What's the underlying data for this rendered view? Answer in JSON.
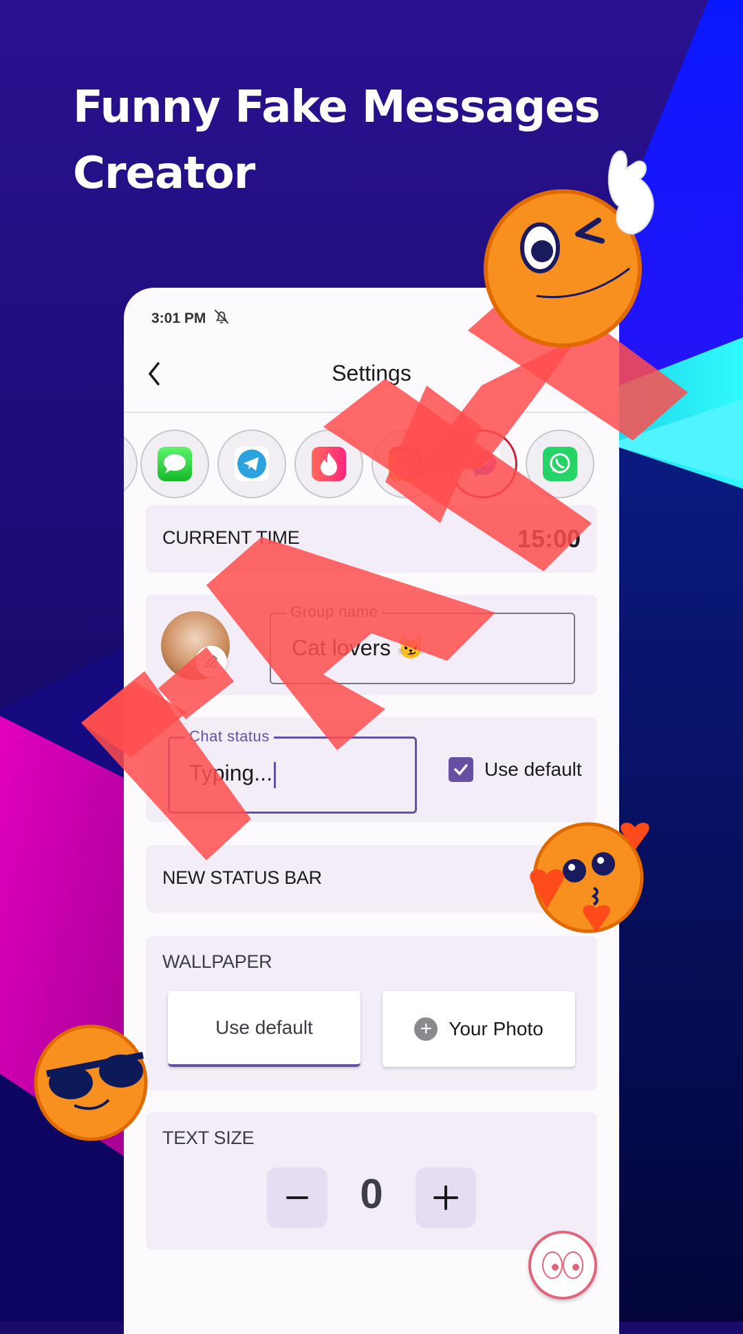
{
  "promo": {
    "title_line1": "Funny Fake Messages",
    "title_line2": "Creator",
    "watermark": "FAKE"
  },
  "status_bar": {
    "time": "3:01 PM",
    "icons": [
      "notifications-muted-icon"
    ]
  },
  "app_bar": {
    "title": "Settings",
    "back_icon": "chevron-left-icon"
  },
  "apps": [
    {
      "name": "partial-app",
      "icon": "app-icon",
      "selected": false
    },
    {
      "name": "imessage",
      "icon": "imessage-icon",
      "selected": false
    },
    {
      "name": "telegram",
      "icon": "telegram-icon",
      "selected": false
    },
    {
      "name": "tinder",
      "icon": "tinder-icon",
      "selected": false
    },
    {
      "name": "instagram",
      "icon": "instagram-icon",
      "selected": false
    },
    {
      "name": "messenger",
      "icon": "messenger-icon",
      "selected": true
    },
    {
      "name": "whatsapp",
      "icon": "whatsapp-icon",
      "selected": false
    }
  ],
  "current_time": {
    "label": "CURRENT TIME",
    "value": "15:00"
  },
  "group": {
    "field_label": "Group name",
    "value": "Cat lovers 😼",
    "avatar_edit_icon": "pencil-icon"
  },
  "chat_status": {
    "field_label": "Chat status",
    "value": "Typing...",
    "checkbox_label": "Use default",
    "checkbox_checked": true
  },
  "new_status_bar": {
    "label": "NEW STATUS BAR"
  },
  "wallpaper": {
    "label": "WALLPAPER",
    "default_button": "Use default",
    "photo_button": "Your Photo",
    "selected": "Use default"
  },
  "text_size": {
    "label": "TEXT SIZE",
    "value": "0",
    "decrement": "−",
    "increment": "+"
  },
  "fab": {
    "icon": "eyes-icon"
  },
  "colors": {
    "accent": "#6750a4",
    "selected_ring": "#c8203c",
    "card_bg": "#f2edf7",
    "watermark": "#ff4d4d",
    "fab_ring": "#e2647a"
  }
}
